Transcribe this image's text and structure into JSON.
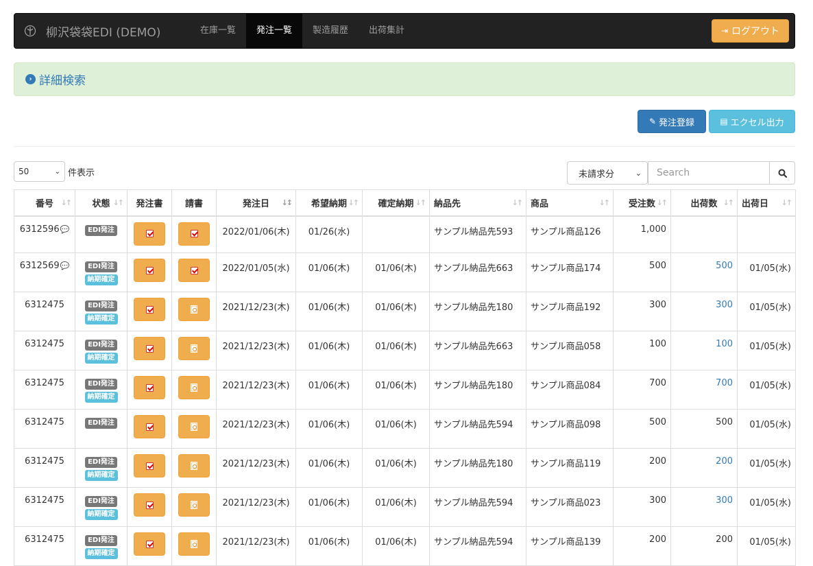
{
  "nav": {
    "brand": "柳沢袋袋EDI (DEMO)",
    "links": [
      "在庫一覧",
      "発注一覧",
      "製造履歴",
      "出荷集計"
    ],
    "active": "発注一覧",
    "logout": "ログアウト"
  },
  "search_panel": {
    "title": "詳細検索"
  },
  "actions": {
    "register": "発注登録",
    "excel": "エクセル出力"
  },
  "controls": {
    "page_length": "50",
    "page_length_label": "件表示",
    "filter_value": "未請求分",
    "search_placeholder": "Search"
  },
  "table": {
    "headers": [
      "番号",
      "状態",
      "発注書",
      "請書",
      "発注日",
      "希望納期",
      "確定納期",
      "納品先",
      "商品",
      "受注数",
      "出荷数",
      "出荷日"
    ],
    "rows": [
      {
        "no": "6312596",
        "comment": true,
        "status": [
          "EDI発注"
        ],
        "ack": "check",
        "order_date": "2022/01/06(木)",
        "wish": "01/26(水)",
        "confirm": "",
        "dest": "サンプル納品先593",
        "product": "サンプル商品126",
        "qty": "1,000",
        "shipped": "",
        "shipped_link": false,
        "ship_date": ""
      },
      {
        "no": "6312569",
        "comment": true,
        "status": [
          "EDI発注",
          "納期確定"
        ],
        "ack": "check",
        "order_date": "2022/01/05(水)",
        "wish": "01/06(木)",
        "confirm": "01/06(木)",
        "dest": "サンプル納品先663",
        "product": "サンプル商品174",
        "qty": "500",
        "shipped": "500",
        "shipped_link": true,
        "ship_date": "01/05(水)"
      },
      {
        "no": "6312475",
        "comment": false,
        "status": [
          "EDI発注",
          "納期確定"
        ],
        "ack": "pdf",
        "order_date": "2021/12/23(木)",
        "wish": "01/06(木)",
        "confirm": "01/06(木)",
        "dest": "サンプル納品先180",
        "product": "サンプル商品192",
        "qty": "300",
        "shipped": "300",
        "shipped_link": true,
        "ship_date": "01/05(水)"
      },
      {
        "no": "6312475",
        "comment": false,
        "status": [
          "EDI発注",
          "納期確定"
        ],
        "ack": "pdf",
        "order_date": "2021/12/23(木)",
        "wish": "01/06(木)",
        "confirm": "01/06(木)",
        "dest": "サンプル納品先663",
        "product": "サンプル商品058",
        "qty": "100",
        "shipped": "100",
        "shipped_link": true,
        "ship_date": "01/05(水)"
      },
      {
        "no": "6312475",
        "comment": false,
        "status": [
          "EDI発注",
          "納期確定"
        ],
        "ack": "pdf",
        "order_date": "2021/12/23(木)",
        "wish": "01/06(木)",
        "confirm": "01/06(木)",
        "dest": "サンプル納品先180",
        "product": "サンプル商品084",
        "qty": "700",
        "shipped": "700",
        "shipped_link": true,
        "ship_date": "01/05(水)"
      },
      {
        "no": "6312475",
        "comment": false,
        "status": [
          "EDI発注"
        ],
        "ack": "pdf",
        "order_date": "2021/12/23(木)",
        "wish": "01/06(木)",
        "confirm": "01/06(木)",
        "dest": "サンプル納品先594",
        "product": "サンプル商品098",
        "qty": "500",
        "shipped": "500",
        "shipped_link": false,
        "ship_date": "01/05(水)"
      },
      {
        "no": "6312475",
        "comment": false,
        "status": [
          "EDI発注",
          "納期確定"
        ],
        "ack": "pdf",
        "order_date": "2021/12/23(木)",
        "wish": "01/06(木)",
        "confirm": "01/06(木)",
        "dest": "サンプル納品先180",
        "product": "サンプル商品119",
        "qty": "200",
        "shipped": "200",
        "shipped_link": true,
        "ship_date": "01/05(水)"
      },
      {
        "no": "6312475",
        "comment": false,
        "status": [
          "EDI発注",
          "納期確定"
        ],
        "ack": "pdf",
        "order_date": "2021/12/23(木)",
        "wish": "01/06(木)",
        "confirm": "01/06(木)",
        "dest": "サンプル納品先594",
        "product": "サンプル商品023",
        "qty": "300",
        "shipped": "300",
        "shipped_link": true,
        "ship_date": "01/05(水)"
      },
      {
        "no": "6312475",
        "comment": false,
        "status": [
          "EDI発注",
          "納期確定"
        ],
        "ack": "pdf",
        "order_date": "2021/12/23(木)",
        "wish": "01/06(木)",
        "confirm": "01/06(木)",
        "dest": "サンプル納品先594",
        "product": "サンプル商品139",
        "qty": "200",
        "shipped": "200",
        "shipped_link": false,
        "ship_date": "01/05(水)"
      }
    ]
  },
  "colors": {
    "navbar": "#222222",
    "warning": "#f0ad4e",
    "primary": "#337ab7",
    "info": "#5bc0de",
    "success_bg": "#dff0d8"
  }
}
